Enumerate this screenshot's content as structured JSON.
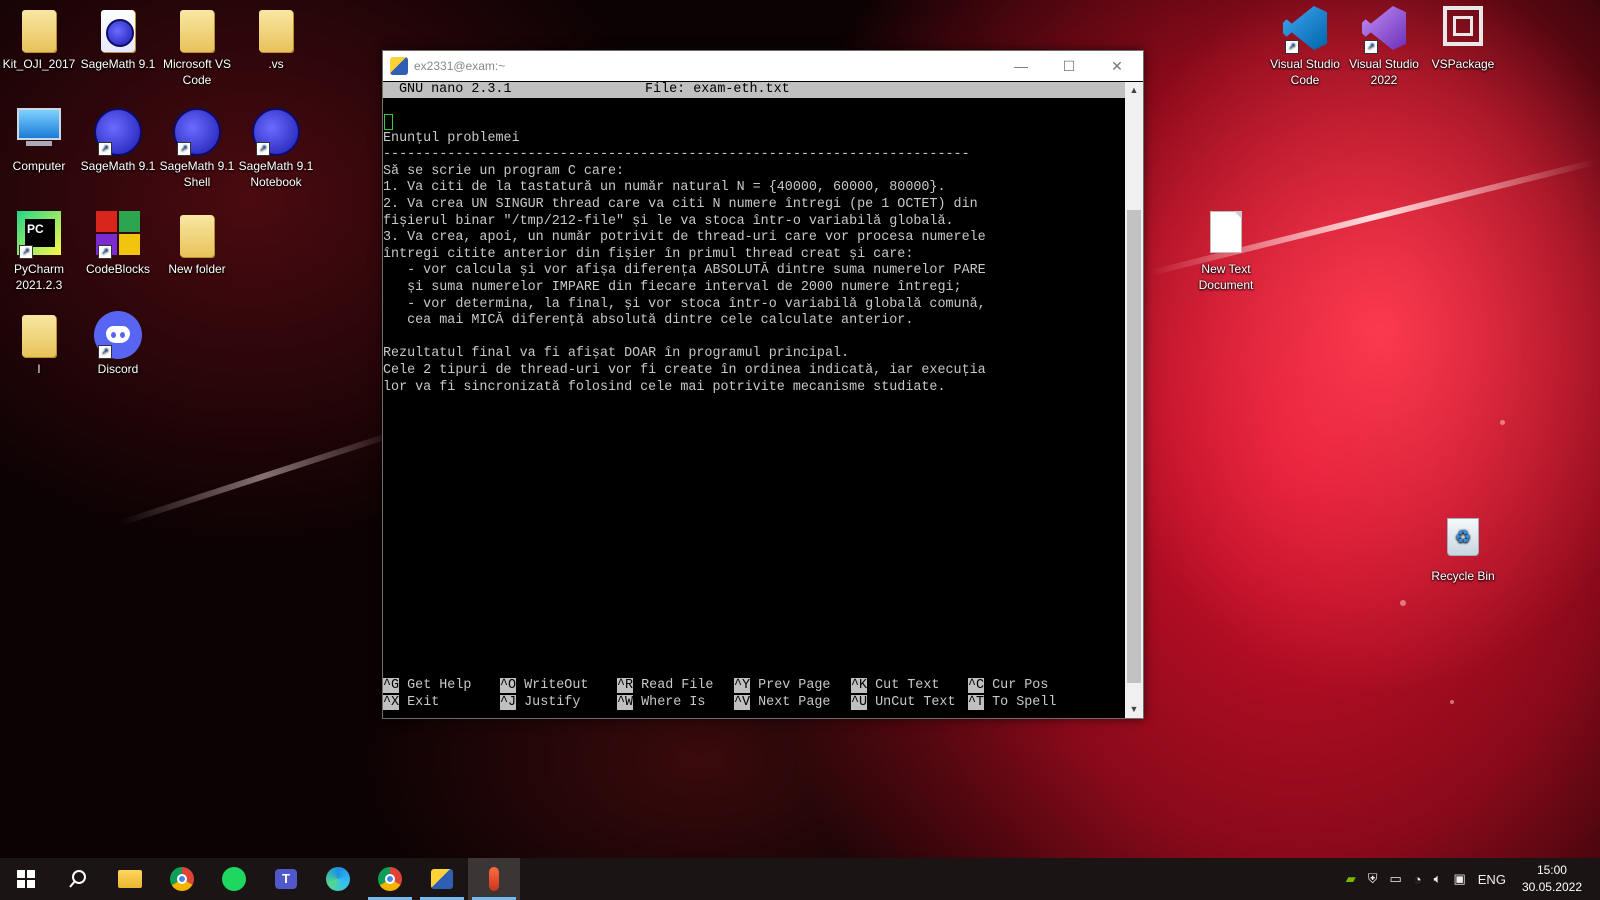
{
  "desktop": {
    "icons": [
      {
        "label": "Kit_OJI_2017",
        "type": "folder"
      },
      {
        "label": "SageMath 9.1",
        "type": "sage-doc"
      },
      {
        "label": "Microsoft VS Code",
        "type": "folder"
      },
      {
        "label": ".vs",
        "type": "folder"
      },
      {
        "label": "Computer",
        "type": "computer"
      },
      {
        "label": "SageMath 9.1",
        "type": "sage"
      },
      {
        "label": "SageMath 9.1 Shell",
        "type": "sage"
      },
      {
        "label": "SageMath 9.1 Notebook",
        "type": "sage"
      },
      {
        "label": "PyCharm 2021.2.3",
        "type": "pycharm"
      },
      {
        "label": "CodeBlocks",
        "type": "codeblocks"
      },
      {
        "label": "New folder",
        "type": "folder"
      },
      {
        "label": "l",
        "type": "folder"
      },
      {
        "label": "Discord",
        "type": "discord"
      },
      {
        "label": "Visual Studio Code",
        "type": "vscode"
      },
      {
        "label": "Visual Studio 2022",
        "type": "vs2022"
      },
      {
        "label": "VSPackage",
        "type": "vspackage"
      },
      {
        "label": "New Text Document",
        "type": "textdoc"
      },
      {
        "label": "Recycle Bin",
        "type": "recycle"
      }
    ]
  },
  "window": {
    "title": "ex2331@exam:~",
    "minimize_label": "—",
    "maximize_label": "☐",
    "close_label": "✕"
  },
  "nano": {
    "version": "GNU nano 2.3.1",
    "file": "File: exam-eth.txt",
    "lines": [
      "",
      "Enunțul problemei",
      "-------------------------------------------------------------------------",
      "Să se scrie un program C care:",
      "1. Va citi de la tastatură un număr natural N = {40000, 60000, 80000}.",
      "2. Va crea UN SINGUR thread care va citi N numere întregi (pe 1 OCTET) din",
      "fișierul binar \"/tmp/212-file\" și le va stoca într-o variabilă globală.",
      "3. Va crea, apoi, un număr potrivit de thread-uri care vor procesa numerele",
      "întregi citite anterior din fișier în primul thread creat și care:",
      "   - vor calcula și vor afișa diferența ABSOLUTĂ dintre suma numerelor PARE",
      "   și suma numerelor IMPARE din fiecare interval de 2000 numere întregi;",
      "   - vor determina, la final, și vor stoca într-o variabilă globală comună,",
      "   cea mai MICĂ diferență absolută dintre cele calculate anterior.",
      "",
      "Rezultatul final va fi afișat DOAR în programul principal.",
      "Cele 2 tipuri de thread-uri vor fi create în ordinea indicată, iar execuția",
      "lor va fi sincronizată folosind cele mai potrivite mecanisme studiate."
    ],
    "shortcuts_row1": [
      {
        "key": "^G",
        "label": "Get Help"
      },
      {
        "key": "^O",
        "label": "WriteOut"
      },
      {
        "key": "^R",
        "label": "Read File"
      },
      {
        "key": "^Y",
        "label": "Prev Page"
      },
      {
        "key": "^K",
        "label": "Cut Text"
      },
      {
        "key": "^C",
        "label": "Cur Pos"
      }
    ],
    "shortcuts_row2": [
      {
        "key": "^X",
        "label": "Exit"
      },
      {
        "key": "^J",
        "label": "Justify"
      },
      {
        "key": "^W",
        "label": "Where Is"
      },
      {
        "key": "^V",
        "label": "Next Page"
      },
      {
        "key": "^U",
        "label": "UnCut Text"
      },
      {
        "key": "^T",
        "label": "To Spell"
      }
    ]
  },
  "taskbar": {
    "apps": [
      "start",
      "search",
      "file-explorer",
      "chrome",
      "spotify",
      "teams",
      "edge",
      "chrome-profile",
      "putty",
      "app-active"
    ],
    "language": "ENG",
    "time": "15:00",
    "date": "30.05.2022"
  }
}
